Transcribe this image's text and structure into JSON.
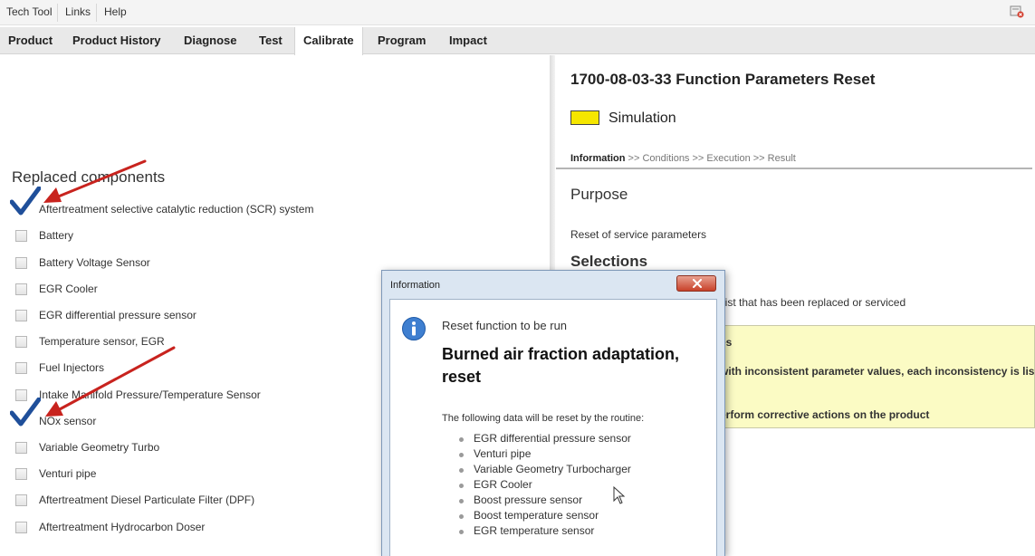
{
  "menubar": {
    "items": [
      "Tech Tool",
      "Links",
      "Help"
    ]
  },
  "tabs": [
    {
      "label": "Product",
      "active": false
    },
    {
      "label": "Product History",
      "active": false
    },
    {
      "label": "Diagnose",
      "active": false
    },
    {
      "label": "Test",
      "active": false
    },
    {
      "label": "Calibrate",
      "active": true
    },
    {
      "label": "Program",
      "active": false
    },
    {
      "label": "Impact",
      "active": false
    }
  ],
  "left": {
    "title": "Replaced components",
    "components": [
      {
        "label": "Aftertreatment selective catalytic reduction (SCR) system",
        "checked": true
      },
      {
        "label": "Battery",
        "checked": false
      },
      {
        "label": "Battery Voltage Sensor",
        "checked": false
      },
      {
        "label": "EGR Cooler",
        "checked": false
      },
      {
        "label": "EGR differential pressure sensor",
        "checked": false
      },
      {
        "label": "Temperature sensor, EGR",
        "checked": false
      },
      {
        "label": "Fuel Injectors",
        "checked": false
      },
      {
        "label": "Intake Manifold Pressure/Temperature Sensor",
        "checked": false
      },
      {
        "label": "NOx sensor",
        "checked": true
      },
      {
        "label": "Variable Geometry Turbo",
        "checked": false
      },
      {
        "label": "Venturi pipe",
        "checked": false
      },
      {
        "label": "Aftertreatment Diesel Particulate Filter (DPF)",
        "checked": false
      },
      {
        "label": "Aftertreatment Hydrocarbon Doser",
        "checked": false
      }
    ]
  },
  "right": {
    "title": "1700-08-03-33 Function Parameters Reset",
    "simulation_label": "Simulation",
    "simulation_color": "#f5e600",
    "breadcrumb": {
      "current": "Information",
      "rest": " >> Conditions >> Execution >> Result"
    },
    "purpose_heading": "Purpose",
    "purpose_text": "Reset of service parameters",
    "selections_heading": "Selections",
    "selections_text": "list that has been replaced or serviced",
    "notice_lines": [
      "es",
      "with inconsistent parameter values, each inconsistency is lis",
      "",
      "erform corrective actions on the product"
    ]
  },
  "dialog": {
    "title": "Information",
    "subtitle": "Reset function to be run",
    "heading": "Burned air fraction adaptation, reset",
    "lead": "The following data will be reset by the routine:",
    "items": [
      "EGR differential pressure sensor",
      "Venturi pipe",
      "Variable Geometry Turbocharger",
      "EGR Cooler",
      "Boost pressure sensor",
      "Boost temperature sensor",
      "EGR temperature sensor"
    ]
  },
  "icons": {
    "exit": "exit-icon",
    "info": "info-icon",
    "close": "close-icon",
    "check": "check-icon",
    "arrow": "red-arrow-annotation",
    "cursor": "mouse-cursor-icon"
  },
  "colors": {
    "check": "#1f4f9a",
    "arrow": "#c8231e",
    "notice_bg": "#fbfbc4"
  }
}
